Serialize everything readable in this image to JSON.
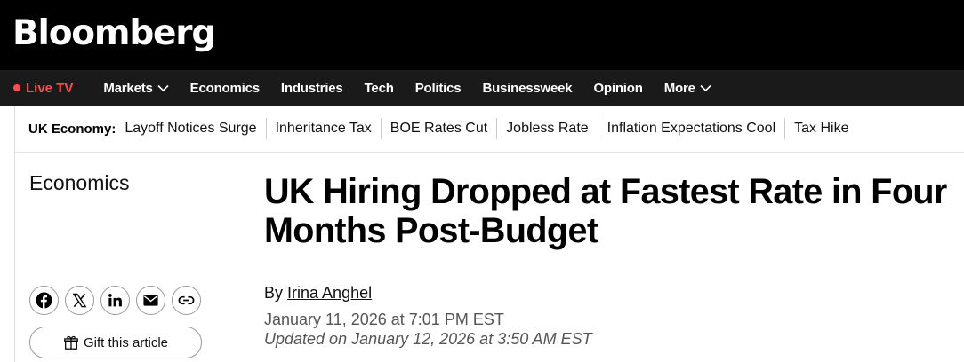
{
  "masthead": {
    "logo": "Bloomberg"
  },
  "nav": {
    "live_label": "Live TV",
    "items": [
      {
        "label": "Markets",
        "dropdown": true
      },
      {
        "label": "Economics"
      },
      {
        "label": "Industries"
      },
      {
        "label": "Tech"
      },
      {
        "label": "Politics"
      },
      {
        "label": "Businessweek"
      },
      {
        "label": "Opinion"
      },
      {
        "label": "More",
        "dropdown": true
      }
    ]
  },
  "topic_bar": {
    "title": "UK Economy:",
    "links": [
      "Layoff Notices Surge",
      "Inheritance Tax",
      "BOE Rates Cut",
      "Jobless Rate",
      "Inflation Expectations Cool",
      "Tax Hike"
    ]
  },
  "article": {
    "section": "Economics",
    "headline": "UK Hiring Dropped at Fastest Rate in Four Months Post-Budget",
    "byline_prefix": "By",
    "author": "Irina Anghel",
    "published": "January 11, 2026 at 7:01 PM EST",
    "updated": "Updated on January 12, 2026 at 3:50 AM EST"
  },
  "share": {
    "icons": [
      "facebook-icon",
      "x-icon",
      "linkedin-icon",
      "email-icon",
      "link-icon"
    ],
    "gift_label": "Gift this article"
  },
  "colors": {
    "live": "#ff4d4d",
    "nav_bg": "#1a1a1a",
    "masthead_bg": "#000000"
  }
}
